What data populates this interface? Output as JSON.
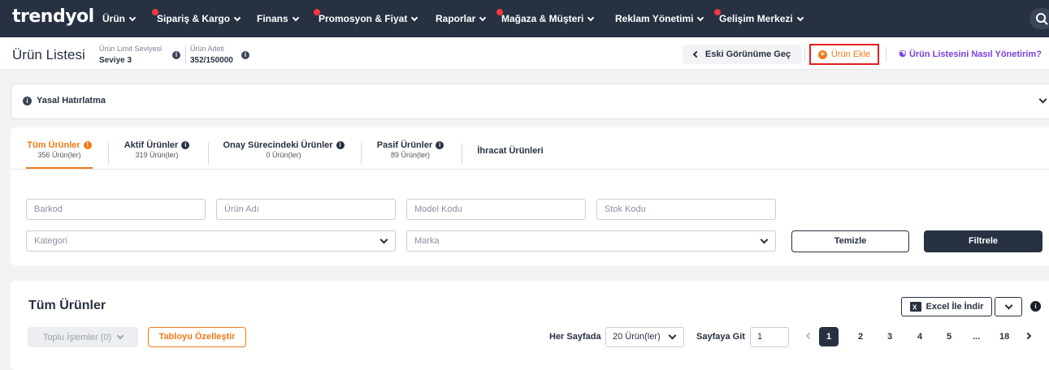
{
  "nav": {
    "logo": "trendyol",
    "items": [
      {
        "label": "Ürün",
        "dot": false
      },
      {
        "label": "Sipariş & Kargo",
        "dot": true
      },
      {
        "label": "Finans",
        "dot": false
      },
      {
        "label": "Promosyon & Fiyat",
        "dot": true
      },
      {
        "label": "Raporlar",
        "dot": false
      },
      {
        "label": "Mağaza & Müşteri",
        "dot": true
      },
      {
        "label": "Reklam Yönetimi",
        "dot": false
      },
      {
        "label": "Gelişim Merkezi",
        "dot": true
      }
    ]
  },
  "header": {
    "title": "Ürün Listesi",
    "limit_label": "Ürün Limit Seviyesi",
    "limit_value": "Seviye 3",
    "count_label": "Ürün Adeti",
    "count_value": "352/150000",
    "old_view": "Eski Görünüme Geç",
    "add_product": "Ürün Ekle",
    "help": "Ürün Listesini Nasıl Yönetirim?"
  },
  "legal": {
    "title": "Yasal Hatırlatma"
  },
  "tabs": [
    {
      "label": "Tüm Ürünler",
      "count": "356 Ürün(ler)"
    },
    {
      "label": "Aktif Ürünler",
      "count": "319 Ürün(ler)"
    },
    {
      "label": "Onay Sürecindeki Ürünler",
      "count": "0 Ürün(ler)"
    },
    {
      "label": "Pasif Ürünler",
      "count": "89 Ürün(ler)"
    },
    {
      "label": "İhracat Ürünleri",
      "count": ""
    }
  ],
  "filters": {
    "barcode": "Barkod",
    "product_name": "Ürün Adı",
    "model_code": "Model Kodu",
    "stock_code": "Stok Kodu",
    "category": "Kategori",
    "brand": "Marka",
    "clear": "Temizle",
    "filter": "Filtrele"
  },
  "list": {
    "title": "Tüm Ürünler",
    "excel": "Excel İle İndir",
    "bulk": "Toplu İşlemler (0)",
    "customize": "Tabloyu Özelleştir",
    "per_page_label": "Her Sayfada",
    "per_page_value": "20 Ürün(ler)",
    "goto_label": "Sayfaya Git",
    "goto_value": "1",
    "pages": [
      "1",
      "2",
      "3",
      "4",
      "5",
      "...",
      "18"
    ]
  }
}
